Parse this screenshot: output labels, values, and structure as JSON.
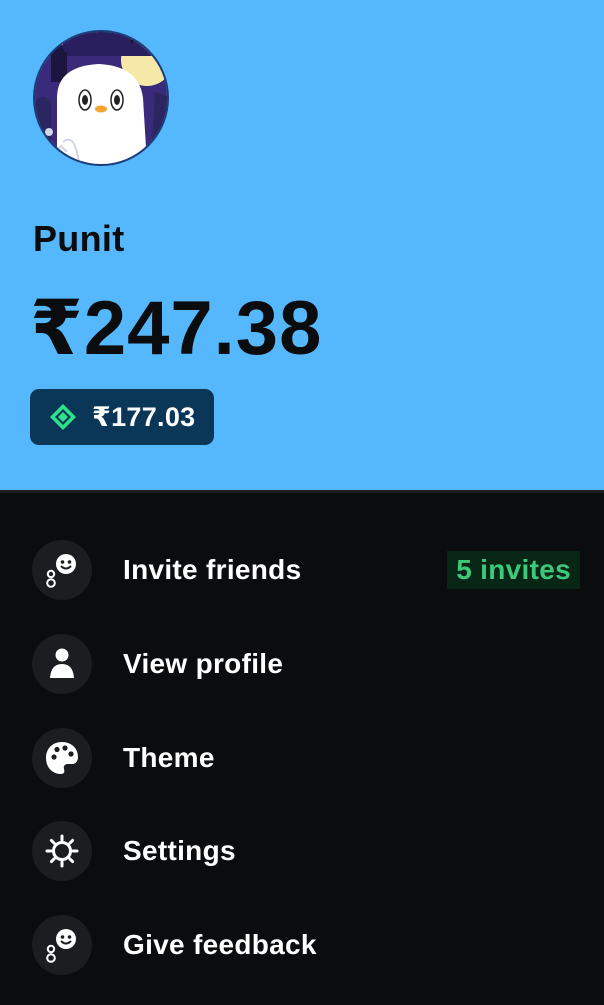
{
  "profile": {
    "username": "Punit",
    "balance": "₹247.38",
    "sub_balance": "₹177.03",
    "avatar_icon": "ghost-penguin-avatar",
    "gem_icon": "green-diamond-icon"
  },
  "menu": {
    "items": [
      {
        "label": "Invite friends",
        "icon": "smiley-bubbles-icon",
        "badge": "5 invites"
      },
      {
        "label": "View profile",
        "icon": "person-icon"
      },
      {
        "label": "Theme",
        "icon": "palette-icon"
      },
      {
        "label": "Settings",
        "icon": "gear-icon"
      },
      {
        "label": "Give feedback",
        "icon": "smiley-bubbles-icon"
      }
    ]
  },
  "colors": {
    "header_bg": "#55b8fd",
    "menu_bg": "#0b0c0e",
    "chip_bg": "#0a3658",
    "badge_text": "#3ec97a",
    "badge_bg": "#082616"
  }
}
